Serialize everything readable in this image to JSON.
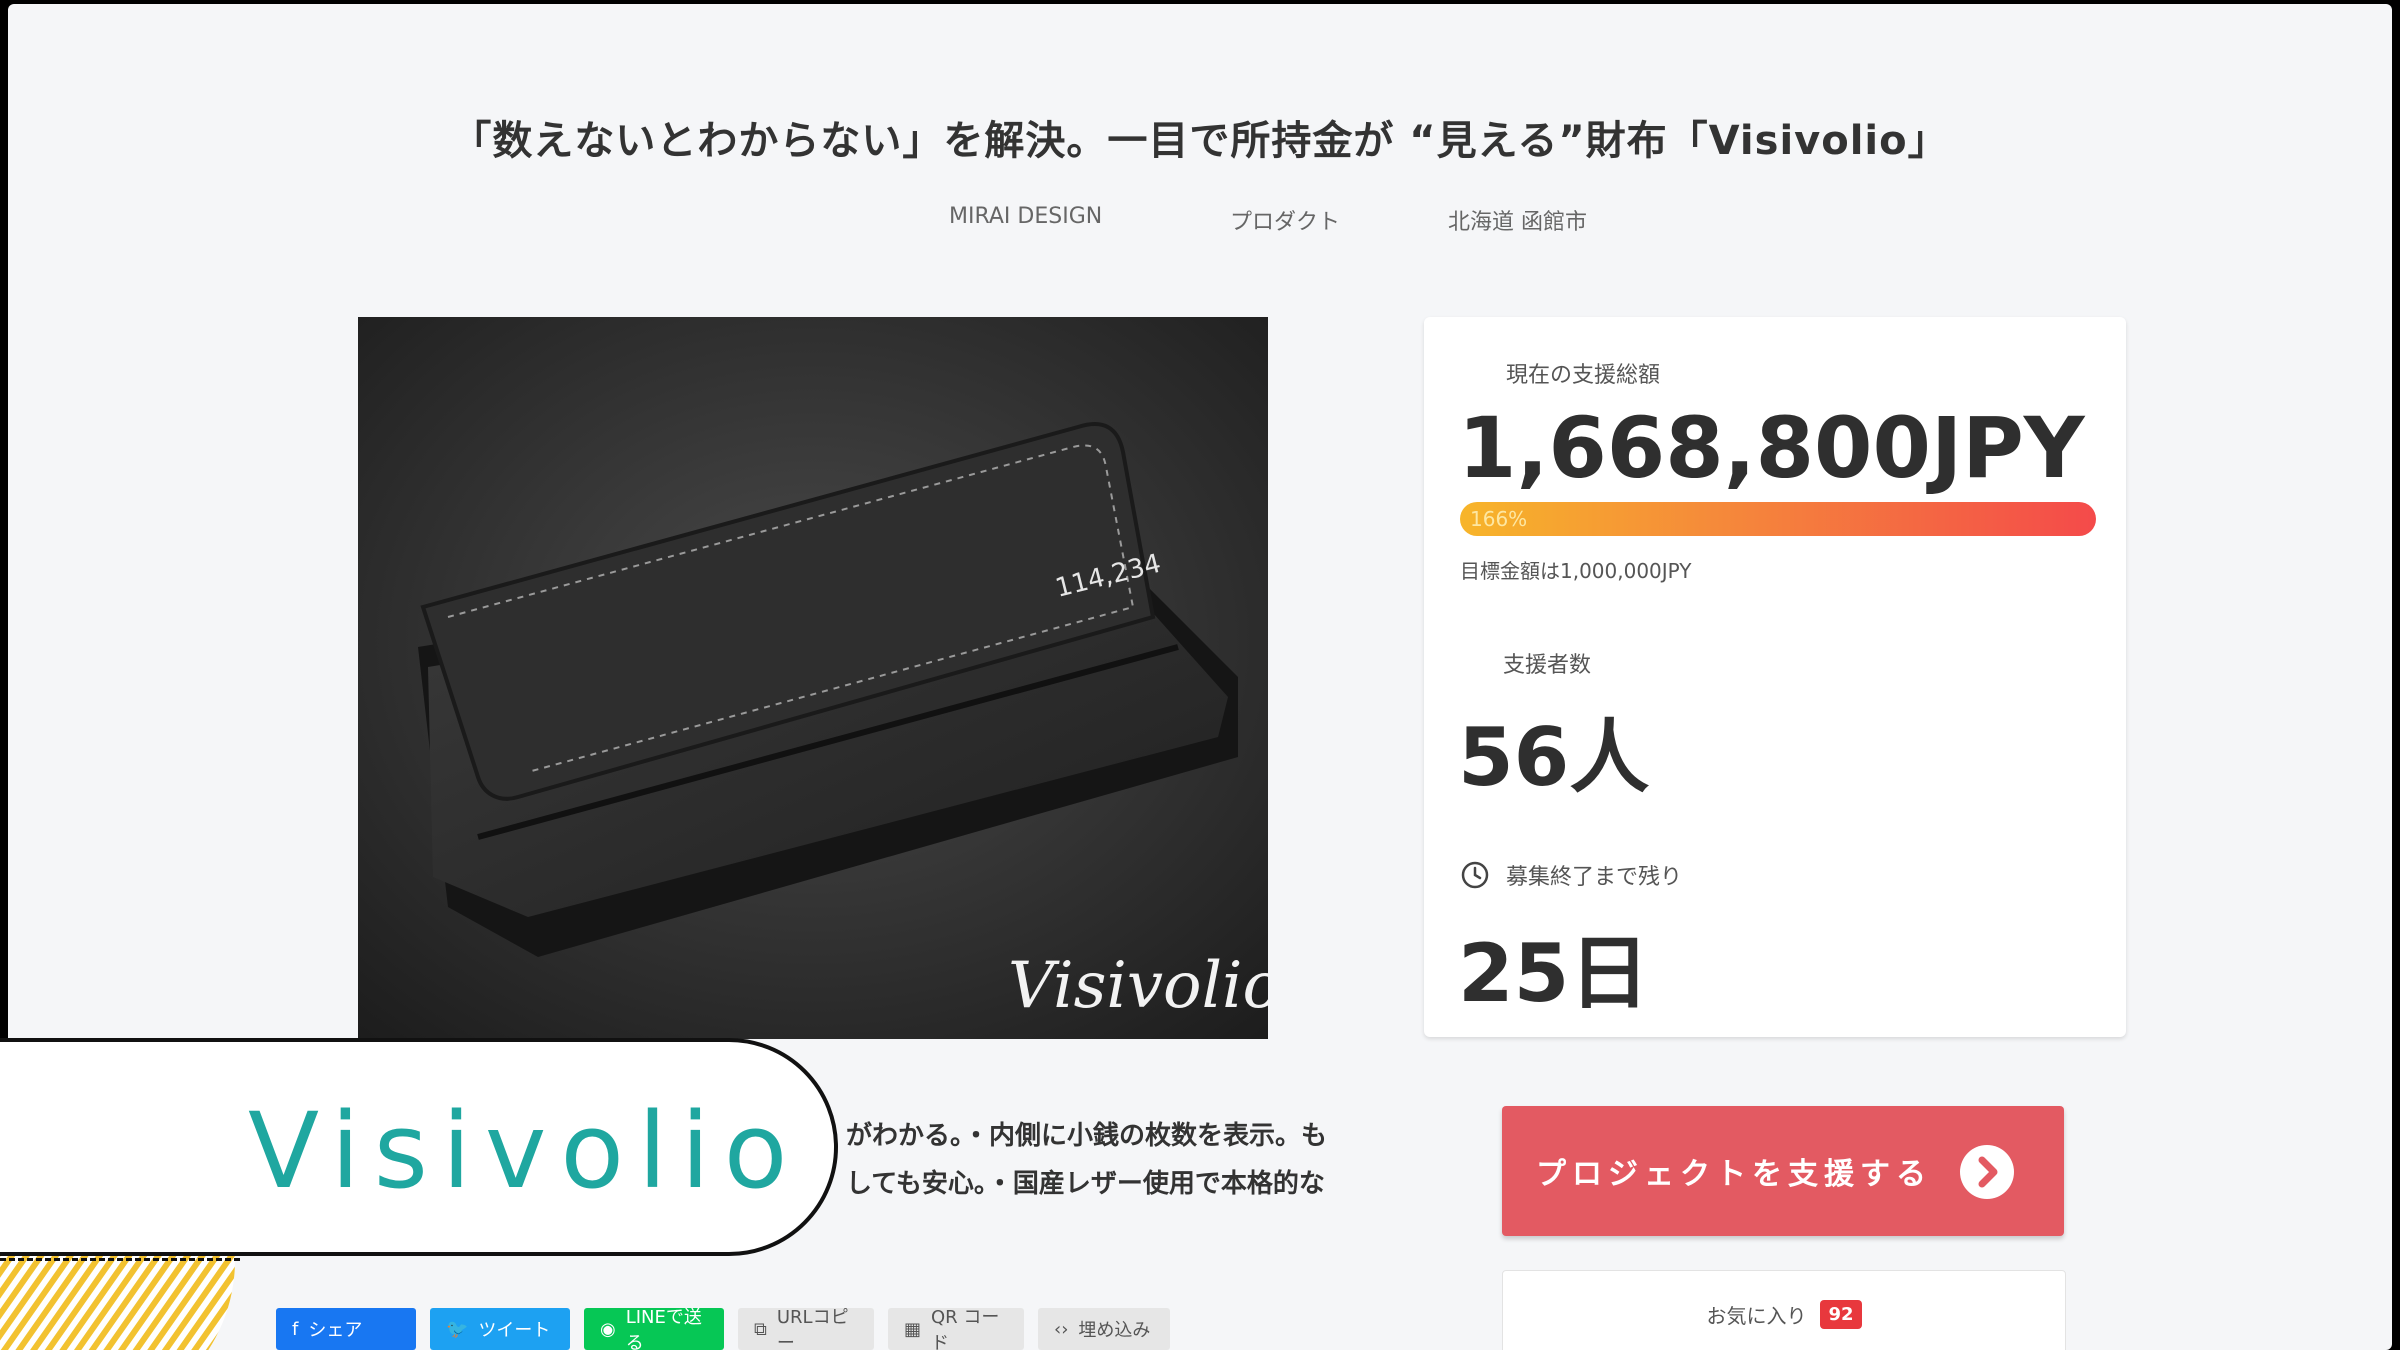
{
  "project": {
    "title": "「数えないとわからない」を解決。一目で所持金が “見える”財布「Visivolio」",
    "owner": "MIRAI DESIGN",
    "category": "プロダクト",
    "location": "北海道 函館市"
  },
  "hero": {
    "wallet_counter": "114,234",
    "signature": "Visivolio"
  },
  "stats": {
    "amount_label": "現在の支援総額",
    "amount_value": "1,668,800JPY",
    "progress_text": "166%",
    "progress_ratio": 1.66,
    "goal_text": "目標金額は1,000,000JPY",
    "backers_label": "支援者数",
    "backers_value": "56人",
    "days_label": "募集終了まで残り",
    "days_value": "25日"
  },
  "description": {
    "line1": "がわかる。・内側に小銭の枚数を表示。も",
    "line2": "しても安心。・国産レザー使用で本格的な"
  },
  "actions": {
    "support_label": "プロジェクトを支援する",
    "favorite_label": "お気に入り",
    "favorite_count": "92"
  },
  "share": {
    "facebook": "シェア",
    "twitter": "ツイート",
    "line": "LINEで送る",
    "url": "URLコピー",
    "qr": "QR コード",
    "embed": "埋め込み"
  },
  "banner": {
    "title": "Visivolio"
  },
  "colors": {
    "support_button": "#e35a62",
    "banner_text": "#1fa7a0",
    "progress_start": "#f7b52a",
    "progress_end": "#f44a4a",
    "favorite_badge": "#e8383d"
  }
}
